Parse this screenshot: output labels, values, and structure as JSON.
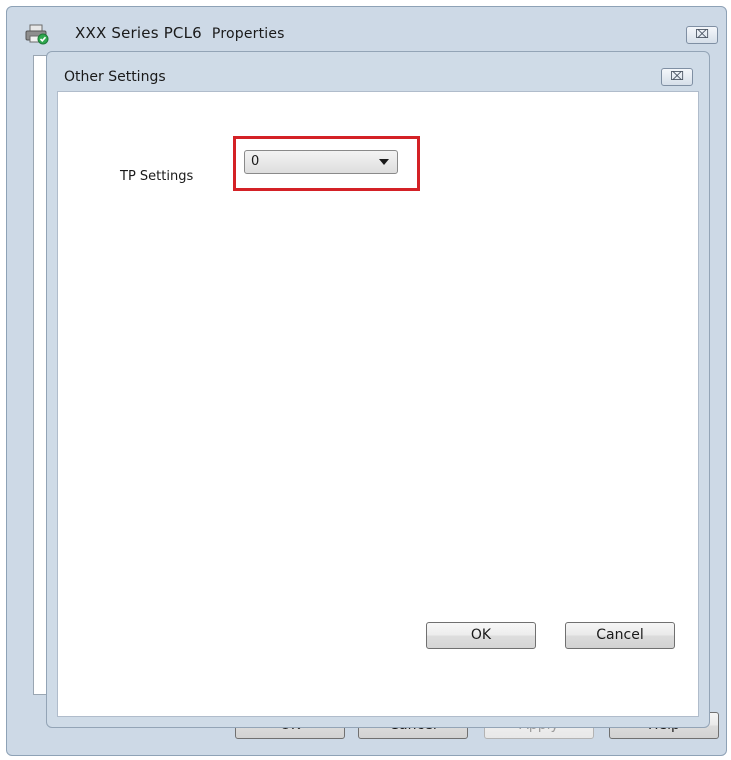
{
  "window": {
    "title": "XXX Series PCL6",
    "title_suffix": "Properties",
    "close_glyph": "⌧",
    "buttons": {
      "ok": "OK",
      "cancel": "Cancel",
      "apply": "Apply",
      "help": "Help"
    }
  },
  "dialog": {
    "title": "Other Settings",
    "close_glyph": "⌧",
    "tp_settings": {
      "label": "TP Settings",
      "value": "0"
    },
    "buttons": {
      "ok": "OK",
      "cancel": "Cancel"
    }
  },
  "colors": {
    "highlight": "#d42126",
    "frame": "#cdd9e6"
  },
  "icons": {
    "app": "printer-icon",
    "close": "close-icon",
    "dropdown": "chevron-down-icon"
  }
}
